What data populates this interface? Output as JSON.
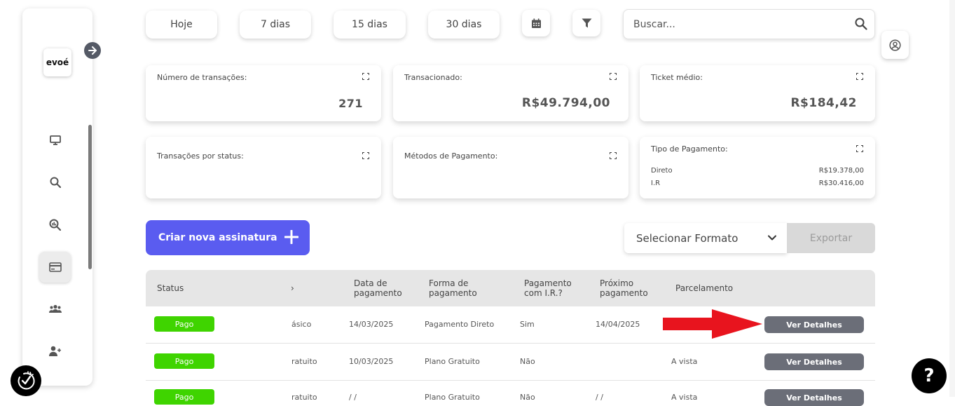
{
  "sidebar": {
    "logo": "evoé",
    "items": [
      {
        "icon": "monitor-icon"
      },
      {
        "icon": "search-icon"
      },
      {
        "icon": "analytics-search-icon"
      },
      {
        "icon": "credit-card-icon",
        "active": true
      },
      {
        "icon": "users-icon"
      },
      {
        "icon": "add-user-icon"
      }
    ]
  },
  "filters": {
    "today": "Hoje",
    "d7": "7 dias",
    "d15": "15 dias",
    "d30": "30 dias"
  },
  "search": {
    "placeholder": "Buscar..."
  },
  "cards": {
    "transactions": {
      "title": "Número de transações:",
      "value": "271"
    },
    "transacted": {
      "title": "Transacionado:",
      "value": "R$49.794,00"
    },
    "ticket": {
      "title": "Ticket médio:",
      "value": "R$184,42"
    },
    "by_status": {
      "title": "Transações por status:"
    },
    "methods": {
      "title": "Métodos de Pagamento:"
    },
    "payment_type": {
      "title": "Tipo de Pagamento:",
      "rows": [
        {
          "label": "Direto",
          "value": "R$19.378,00"
        },
        {
          "label": "I.R",
          "value": "R$30.416,00"
        }
      ]
    }
  },
  "actions": {
    "create": "Criar nova assinatura",
    "format": "Selecionar Formato",
    "export": "Exportar"
  },
  "table": {
    "headers": {
      "status": "Status",
      "plan": "›",
      "date": "Data de pagamento",
      "method": "Forma de pagamento",
      "ir": "Pagamento com I.R.?",
      "next": "Próximo pagamento",
      "installments": "Parcelamento"
    },
    "rows": [
      {
        "status": "Pago",
        "plan": "ásico",
        "date": "14/03/2025",
        "method": "Pagamento Direto",
        "ir": "Sim",
        "next": "14/04/2025",
        "installments": "",
        "action": "Ver Detalhes"
      },
      {
        "status": "Pago",
        "plan": "ratuito",
        "date": "10/03/2025",
        "method": "Plano Gratuito",
        "ir": "Não",
        "next": "",
        "installments": "A vista",
        "action": "Ver Detalhes"
      },
      {
        "status": "Pago",
        "plan": "ratuito",
        "date": "/ /",
        "method": "Plano Gratuito",
        "ir": "Não",
        "next": "/ /",
        "installments": "A vista",
        "action": "Ver Detalhes"
      }
    ]
  },
  "help": "?",
  "colors": {
    "primary": "#5a5cf0",
    "paid": "#3fd400",
    "details": "#6b6e78",
    "arrow": "#e8141e"
  }
}
